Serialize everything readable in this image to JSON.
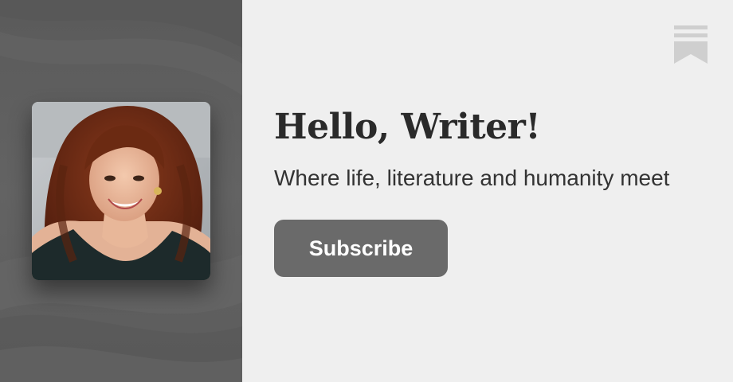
{
  "publication": {
    "title": "Hello, Writer!",
    "tagline": "Where life, literature and humanity meet",
    "subscribe_label": "Subscribe"
  },
  "logo": {
    "icon": "bookmark-icon"
  },
  "colors": {
    "left_panel": "#616161",
    "right_panel": "#efefef",
    "button": "#6a6a6a",
    "button_text": "#ffffff",
    "title_text": "#2a2a2a",
    "logo": "#cfcfcf"
  }
}
